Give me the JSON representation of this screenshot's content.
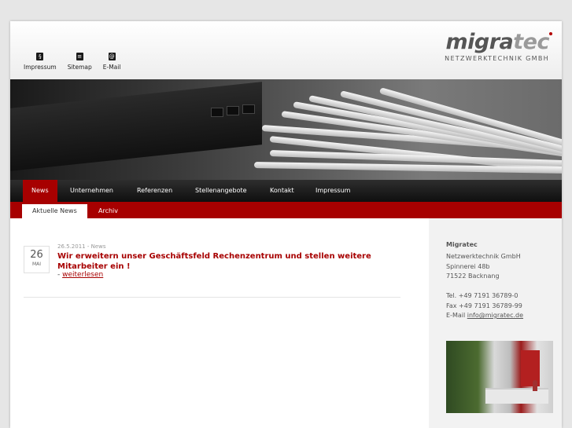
{
  "header": {
    "top_links": [
      {
        "label": "Impressum",
        "icon": "§",
        "icon_name": "paragraph-icon"
      },
      {
        "label": "Sitemap",
        "icon": "≡",
        "icon_name": "sitemap-icon"
      },
      {
        "label": "E-Mail",
        "icon": "@",
        "icon_name": "email-icon"
      }
    ],
    "logo_part1": "migra",
    "logo_part2": "tec",
    "logo_subtitle": "NETZWERKTECHNIK GMBH"
  },
  "nav": {
    "items": [
      "News",
      "Unternehmen",
      "Referenzen",
      "Stellenangebote",
      "Kontakt",
      "Impressum"
    ],
    "active": "News"
  },
  "subnav": {
    "items": [
      "Aktuelle News",
      "Archiv"
    ],
    "active": "Aktuelle News"
  },
  "news": [
    {
      "day": "26",
      "month": "MAI",
      "meta": "26.5.2011 - News",
      "title": "Wir erweitern unser Geschäftsfeld Rechenzentrum und stellen weitere Mitarbeiter ein !",
      "more_prefix": "- ",
      "more_label": "weiterlesen"
    }
  ],
  "sidebar": {
    "company": "Migratec",
    "lines": [
      "Netzwerktechnik GmbH",
      "Spinnerei 48b",
      "71522 Backnang",
      "",
      "Tel. +49 7191 36789-0",
      "Fax +49 7191 36789-99"
    ],
    "email_label": "E-Mail ",
    "email": "info@migratec.de"
  },
  "colors": {
    "brand_red": "#a70000",
    "nav_dark": "#1a1a1a"
  }
}
